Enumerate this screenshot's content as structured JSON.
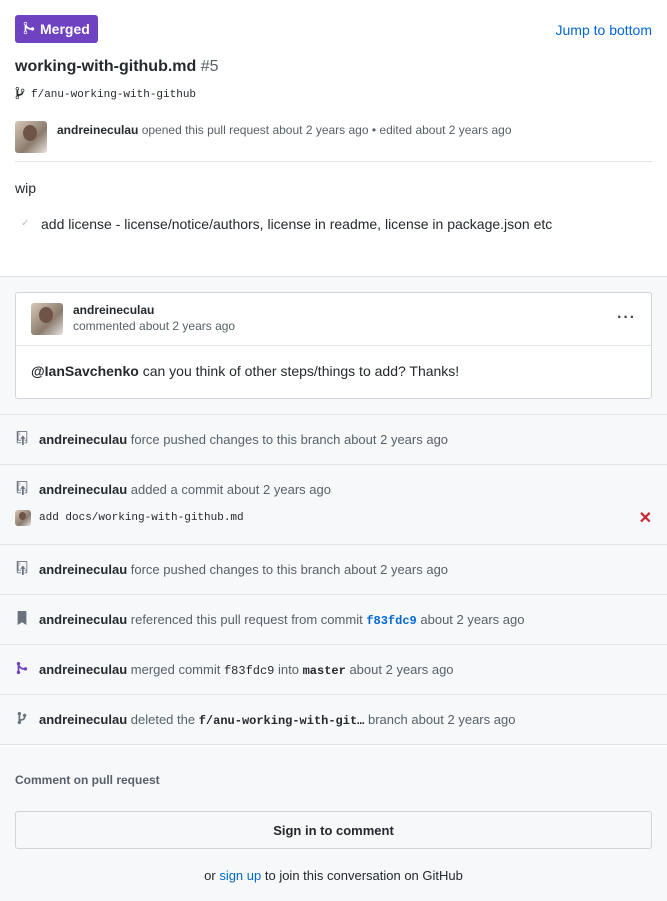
{
  "status_badge": "Merged",
  "jump_link": "Jump to bottom",
  "pr": {
    "title": "working-with-github.md",
    "number": "#5",
    "branch": "f/anu-working-with-github",
    "author": "andreineculau",
    "opened_text": "opened this pull request about 2 years ago",
    "edited_text": "• edited about 2 years ago",
    "body": "wip",
    "task": "add license - license/notice/authors, license in readme, license in package.json etc"
  },
  "comment": {
    "author": "andreineculau",
    "when": "commented about 2 years ago",
    "menu": "···",
    "mention": "@IanSavchenko",
    "text": "can you think of other steps/things to add? Thanks!"
  },
  "events": {
    "e1": {
      "actor": "andreineculau",
      "text": "force pushed changes to this branch about 2 years ago"
    },
    "e2": {
      "actor": "andreineculau",
      "text": "added a commit about 2 years ago",
      "commit_msg": "add docs/working-with-github.md"
    },
    "e3": {
      "actor": "andreineculau",
      "text": "force pushed changes to this branch about 2 years ago"
    },
    "e4": {
      "actor": "andreineculau",
      "pre": "referenced this pull request from commit",
      "sha": "f83fdc9",
      "post": "about 2 years ago"
    },
    "e5": {
      "actor": "andreineculau",
      "pre": "merged commit",
      "sha": "f83fdc9",
      "mid": "into",
      "target": "master",
      "post": "about 2 years ago"
    },
    "e6": {
      "actor": "andreineculau",
      "pre": "deleted the",
      "branch": "f/anu-working-with-git…",
      "post": "branch about 2 years ago"
    }
  },
  "footer": {
    "label": "Comment on pull request",
    "signin": "Sign in to comment",
    "or": "or",
    "signup": "sign up",
    "join": "to join this conversation on GitHub"
  },
  "colors": {
    "merged": "#6f42c1",
    "link": "#0366d6",
    "danger": "#cb2431"
  }
}
